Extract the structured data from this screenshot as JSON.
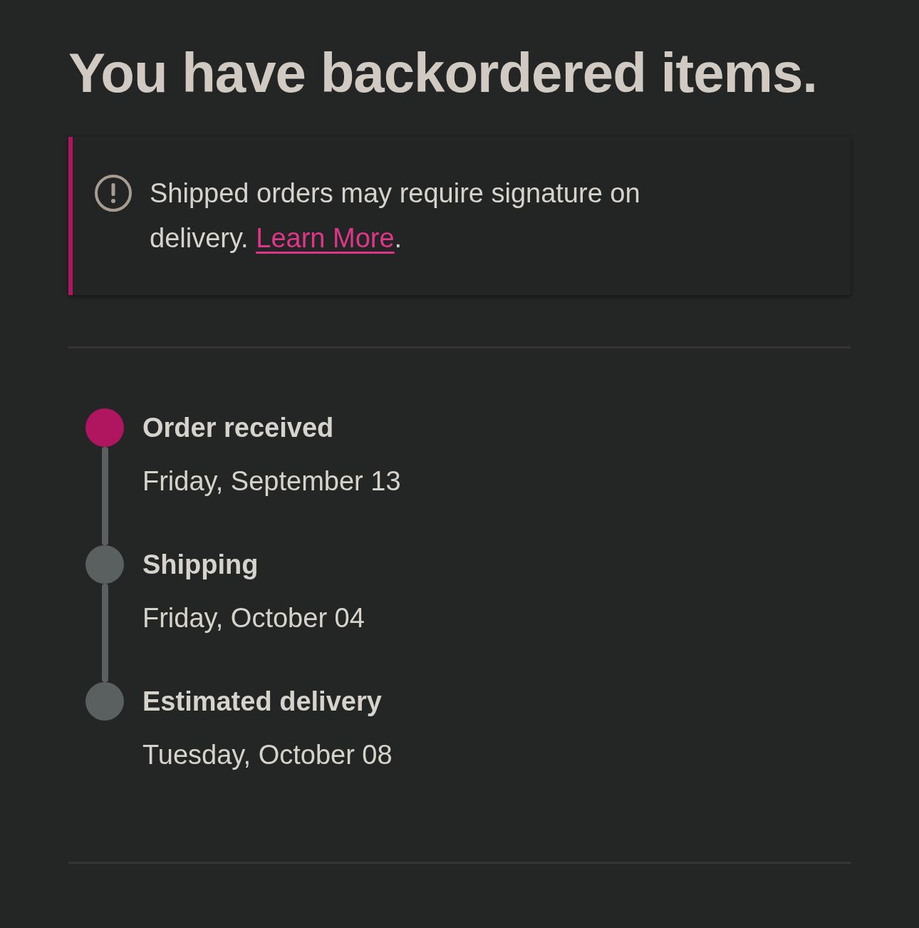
{
  "heading": "You have backordered items.",
  "notice": {
    "text": "Shipped orders may require signature on delivery.",
    "link": "Learn More",
    "after_link": "."
  },
  "steps": [
    {
      "title": "Order received",
      "date": "Friday, September 13",
      "completed": true
    },
    {
      "title": "Shipping",
      "date": "Friday, October 04",
      "completed": false
    },
    {
      "title": "Estimated delivery",
      "date": "Tuesday, October 08",
      "completed": false
    }
  ]
}
